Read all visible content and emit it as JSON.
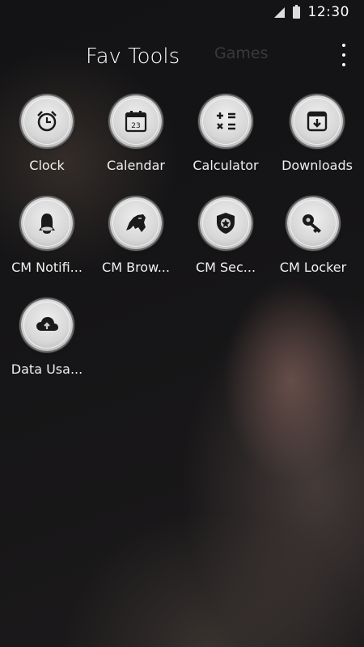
{
  "status_bar": {
    "time": "12:30",
    "signal_icon": "signal-icon",
    "battery_icon": "battery-icon"
  },
  "tabs": [
    {
      "label": "Fav Tools",
      "active": true
    },
    {
      "label": "Games",
      "active": false
    }
  ],
  "menu_icon": "overflow-menu-icon",
  "apps": [
    {
      "label": "Clock",
      "icon": "alarm-clock-icon"
    },
    {
      "label": "Calendar",
      "icon": "calendar-icon",
      "icon_text": "23"
    },
    {
      "label": "Calculator",
      "icon": "calculator-icon"
    },
    {
      "label": "Downloads",
      "icon": "download-icon"
    },
    {
      "label": "CM Notifi...",
      "icon": "bell-icon"
    },
    {
      "label": "CM Brow...",
      "icon": "panther-icon"
    },
    {
      "label": "CM Sec...",
      "icon": "police-badge-icon"
    },
    {
      "label": "CM Locker",
      "icon": "key-icon"
    },
    {
      "label": "Data Usa...",
      "icon": "cloud-upload-icon"
    }
  ],
  "colors": {
    "icon_glyph": "#1a1a1a",
    "icon_face": "#e0e0e0",
    "inactive_tab": "#3a3a3c"
  }
}
